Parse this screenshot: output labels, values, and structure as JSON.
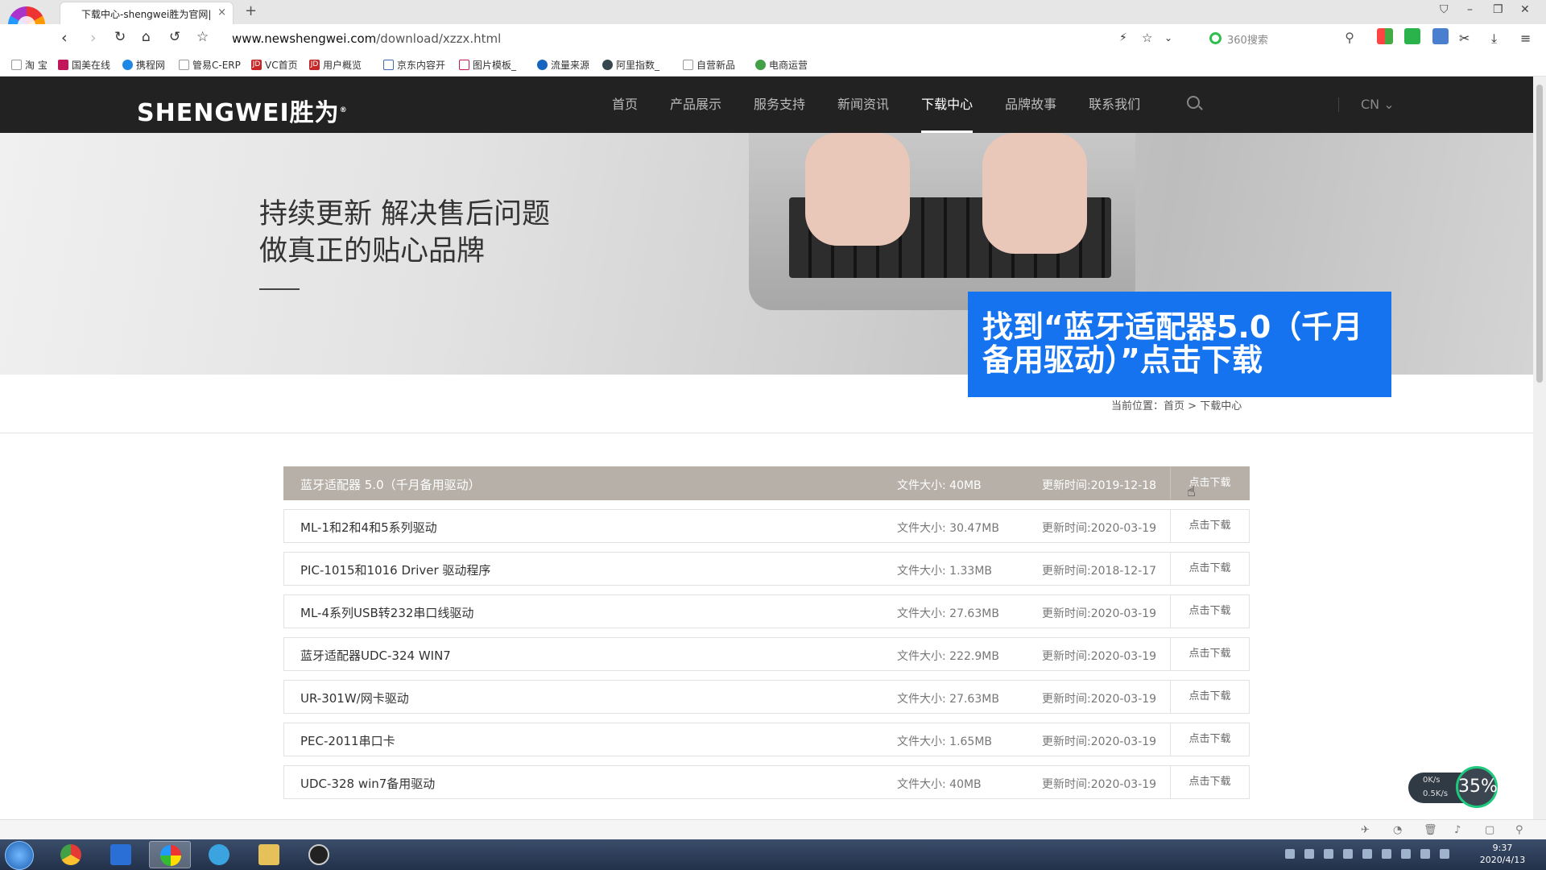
{
  "browser": {
    "tab_title": "下载中心-shengwei胜为官网|",
    "url_host": "www.newshengwei.com",
    "url_path": "/download/xzzx.html",
    "search_placeholder": "360搜索",
    "bookmarks": [
      "淘 宝",
      "国美在线",
      "携程网",
      "管易C-ERP",
      "VC首页",
      "用户概览",
      "京东内容开",
      "图片模板_",
      "流量来源",
      "阿里指数_",
      "自营新品",
      "电商运营"
    ]
  },
  "site": {
    "logo": "SHENGWEI胜为",
    "logo_mark": "®",
    "nav": [
      "首页",
      "产品展示",
      "服务支持",
      "新闻资讯",
      "下载中心",
      "品牌故事",
      "联系我们"
    ],
    "active_nav": "下载中心",
    "lang": "CN"
  },
  "banner": {
    "line1": "持续更新 解决售后问题",
    "line2": "做真正的贴心品牌"
  },
  "overlay_caption": "找到“蓝牙适配器5.0（千月备用驱动）”点击下载",
  "breadcrumb": {
    "prefix": "当前位置：",
    "home": "首页",
    "sep": ">",
    "current": "下载中心"
  },
  "downloads": [
    {
      "name": "蓝牙适配器 5.0（千月备用驱动）",
      "size": "文件大小: 40MB",
      "date": "更新时间:2019-12-18",
      "action": "点击下载"
    },
    {
      "name": "ML-1和2和4和5系列驱动",
      "size": "文件大小: 30.47MB",
      "date": "更新时间:2020-03-19",
      "action": "点击下载"
    },
    {
      "name": "PIC-1015和1016 Driver 驱动程序",
      "size": "文件大小: 1.33MB",
      "date": "更新时间:2018-12-17",
      "action": "点击下载"
    },
    {
      "name": "ML-4系列USB转232串口线驱动",
      "size": "文件大小: 27.63MB",
      "date": "更新时间:2020-03-19",
      "action": "点击下载"
    },
    {
      "name": "蓝牙适配器UDC-324 WIN7",
      "size": "文件大小: 222.9MB",
      "date": "更新时间:2020-03-19",
      "action": "点击下载"
    },
    {
      "name": "UR-301W/网卡驱动",
      "size": "文件大小: 27.63MB",
      "date": "更新时间:2020-03-19",
      "action": "点击下载"
    },
    {
      "name": "PEC-2011串口卡",
      "size": "文件大小: 1.65MB",
      "date": "更新时间:2020-03-19",
      "action": "点击下载"
    },
    {
      "name": "UDC-328 win7备用驱动",
      "size": "文件大小: 40MB",
      "date": "更新时间:2020-03-19",
      "action": "点击下载"
    }
  ],
  "netspeed": {
    "up": "0K/s",
    "down": "0.5K/s",
    "percent": "35%"
  },
  "taskbar": {
    "time": "9:37",
    "date": "2020/4/13"
  }
}
